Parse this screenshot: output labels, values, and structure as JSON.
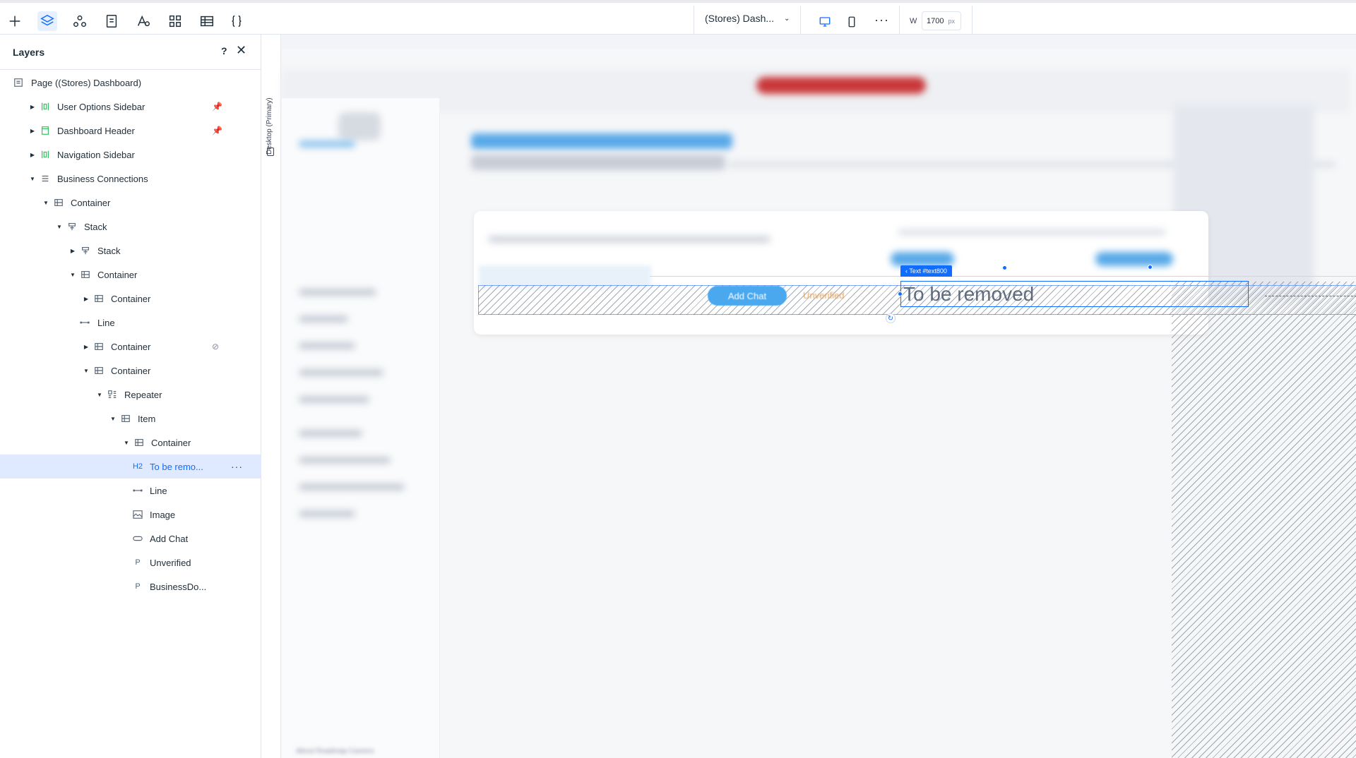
{
  "toolbar": {
    "tools": [
      {
        "name": "add-icon"
      },
      {
        "name": "layers-icon",
        "active": true
      },
      {
        "name": "components-icon"
      },
      {
        "name": "pages-icon"
      },
      {
        "name": "text-theme-icon"
      },
      {
        "name": "app-market-icon"
      },
      {
        "name": "cms-table-icon"
      },
      {
        "name": "code-braces-icon"
      }
    ],
    "page_selector": "(Stores) Dash...",
    "width_label": "W",
    "width_value": "1700",
    "width_unit": "px",
    "accent_color": "#116dff"
  },
  "layers_panel": {
    "title": "Layers",
    "help": "?",
    "close": "✕",
    "items": [
      {
        "label": "Page ((Stores) Dashboard)",
        "icon": "page-icon"
      },
      {
        "label": "User Options Sidebar",
        "icon": "sidebar-icon",
        "pinned": true
      },
      {
        "label": "Dashboard Header",
        "icon": "header-icon",
        "pinned": true
      },
      {
        "label": "Navigation Sidebar",
        "icon": "sidebar-icon"
      },
      {
        "label": "Business Connections",
        "icon": "section-icon"
      },
      {
        "label": "Container",
        "icon": "container-icon"
      },
      {
        "label": "Stack",
        "icon": "stack-icon"
      },
      {
        "label": "Stack",
        "icon": "stack-icon"
      },
      {
        "label": "Container",
        "icon": "container-icon"
      },
      {
        "label": "Container",
        "icon": "container-icon"
      },
      {
        "label": "Line",
        "icon": "line-icon"
      },
      {
        "label": "Container",
        "icon": "container-icon",
        "hidden": true
      },
      {
        "label": "Container",
        "icon": "container-icon"
      },
      {
        "label": "Repeater",
        "icon": "repeater-icon"
      },
      {
        "label": "Item",
        "icon": "container-icon"
      },
      {
        "label": "Container",
        "icon": "container-icon"
      },
      {
        "label": "To be remo...",
        "icon_text": "H2",
        "selected": true
      },
      {
        "label": "Line",
        "icon": "line-icon"
      },
      {
        "label": "Image",
        "icon": "image-icon"
      },
      {
        "label": "Add Chat",
        "icon": "button-icon"
      },
      {
        "label": "Unverified",
        "icon_text": "P"
      },
      {
        "label": "BusinessDo...",
        "icon_text": "P"
      }
    ],
    "more": "···"
  },
  "canvas": {
    "breakpoint_label": "Desktop (Primary)",
    "selected_tag": "‹ Text #text800",
    "selected_text": "To be removed",
    "add_chat_label": "Add Chat",
    "unverified_label": "Unverified",
    "footer": "About  Roadmap  Careers",
    "unverified_color": "#e2a25c"
  }
}
